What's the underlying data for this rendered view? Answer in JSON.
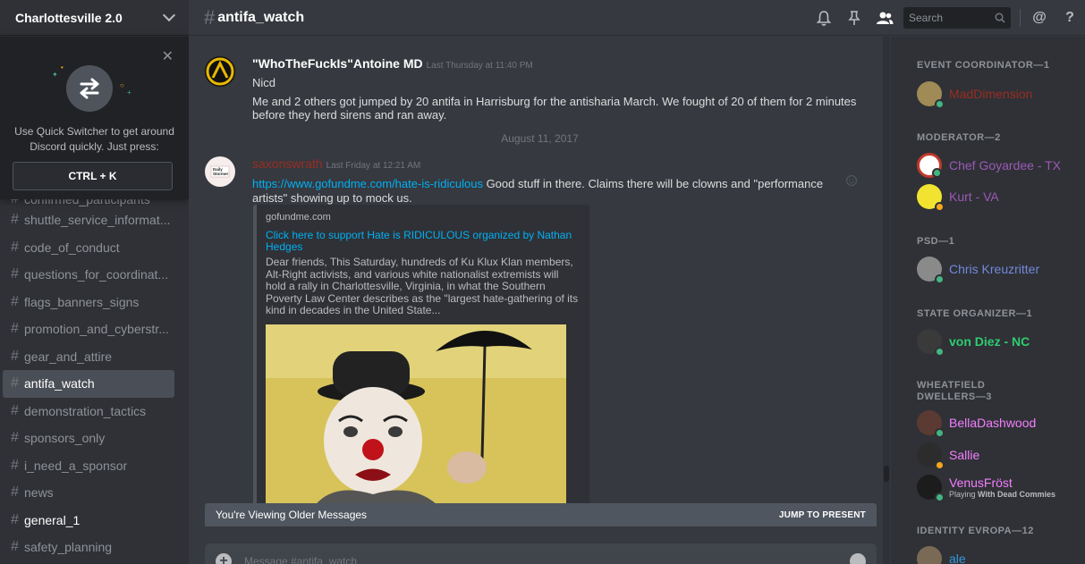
{
  "server": {
    "name": "Charlottesville 2.0"
  },
  "quick_switcher": {
    "text": "Use Quick Switcher to get around Discord quickly. Just press:",
    "shortcut": "CTRL + K"
  },
  "channels": [
    {
      "name": "confirmed_participants"
    },
    {
      "name": "shuttle_service_informat..."
    },
    {
      "name": "code_of_conduct"
    },
    {
      "name": "questions_for_coordinat..."
    },
    {
      "name": "flags_banners_signs"
    },
    {
      "name": "promotion_and_cyberstr..."
    },
    {
      "name": "gear_and_attire"
    },
    {
      "name": "antifa_watch"
    },
    {
      "name": "demonstration_tactics"
    },
    {
      "name": "sponsors_only"
    },
    {
      "name": "i_need_a_sponsor"
    },
    {
      "name": "news"
    },
    {
      "name": "general_1"
    },
    {
      "name": "safety_planning"
    }
  ],
  "header": {
    "hash": "#",
    "channel": "antifa_watch",
    "search_placeholder": "Search",
    "mention": "@",
    "help": "?"
  },
  "messages": [
    {
      "author": "\"WhoTheFuckIs\"Antoine MD",
      "timestamp": "Last Thursday at 11:40 PM",
      "line1": "Nicd",
      "line2": "Me and 2 others got jumped by 20 antifa in Harrisburg for the antisharia March. We  fought of 20 of them for 2 minutes before they herd sirens and ran away."
    },
    {
      "author": "saxonswrath",
      "timestamp": "Last Friday at 12:21 AM",
      "link": "https://www.gofundme.com/hate-is-ridiculous",
      "text": " Good stuff in there. Claims there will be clowns and \"performance artists\" showing up to mock us."
    }
  ],
  "date_divider": "August 11, 2017",
  "embed": {
    "provider": "gofundme.com",
    "title": "Click here to support Hate is RIDICULOUS organized by Nathan Hedges",
    "description": "Dear friends, This Saturday, hundreds of Ku Klux Klan members, Alt-Right activists, and various white nationalist extremists will hold a rally in Charlottesville, Virginia, in what the Southern Poverty Law Center describes as the \"largest hate-gathering of its kind in decades in the United State..."
  },
  "older_bar": {
    "label": "You're Viewing Older Messages",
    "jump": "JUMP TO PRESENT"
  },
  "composer": {
    "placeholder": "Message #antifa_watch"
  },
  "member_groups": [
    {
      "role": "EVENT COORDINATOR—1",
      "members": [
        {
          "name": "MadDimension",
          "color": "#992d22",
          "status": "online"
        }
      ]
    },
    {
      "role": "MODERATOR—2",
      "members": [
        {
          "name": "Chef Goyardee - TX",
          "color": "#9b59b6",
          "status": "online"
        },
        {
          "name": "Kurt - VA",
          "color": "#9b59b6",
          "status": "idle"
        }
      ]
    },
    {
      "role": "PSD—1",
      "members": [
        {
          "name": "Chris Kreuzritter",
          "color": "#7289da",
          "status": "online"
        }
      ]
    },
    {
      "role": "STATE ORGANIZER—1",
      "members": [
        {
          "name": "von Diez - NC",
          "color": "#2ecc71",
          "status": "online"
        }
      ]
    },
    {
      "role": "WHEATFIELD DWELLERS—3",
      "members": [
        {
          "name": "BellaDashwood",
          "color": "#f47fff",
          "status": "online"
        },
        {
          "name": "Sallie",
          "color": "#f47fff",
          "status": "idle"
        },
        {
          "name": "VenusFröst",
          "color": "#f47fff",
          "status": "online",
          "playing_prefix": "Playing ",
          "playing_game": "With Dead Commies"
        }
      ]
    },
    {
      "role": "IDENTITY EVROPA—12",
      "members": [
        {
          "name": "ale",
          "color": "#3498db",
          "status": "online"
        }
      ]
    }
  ]
}
